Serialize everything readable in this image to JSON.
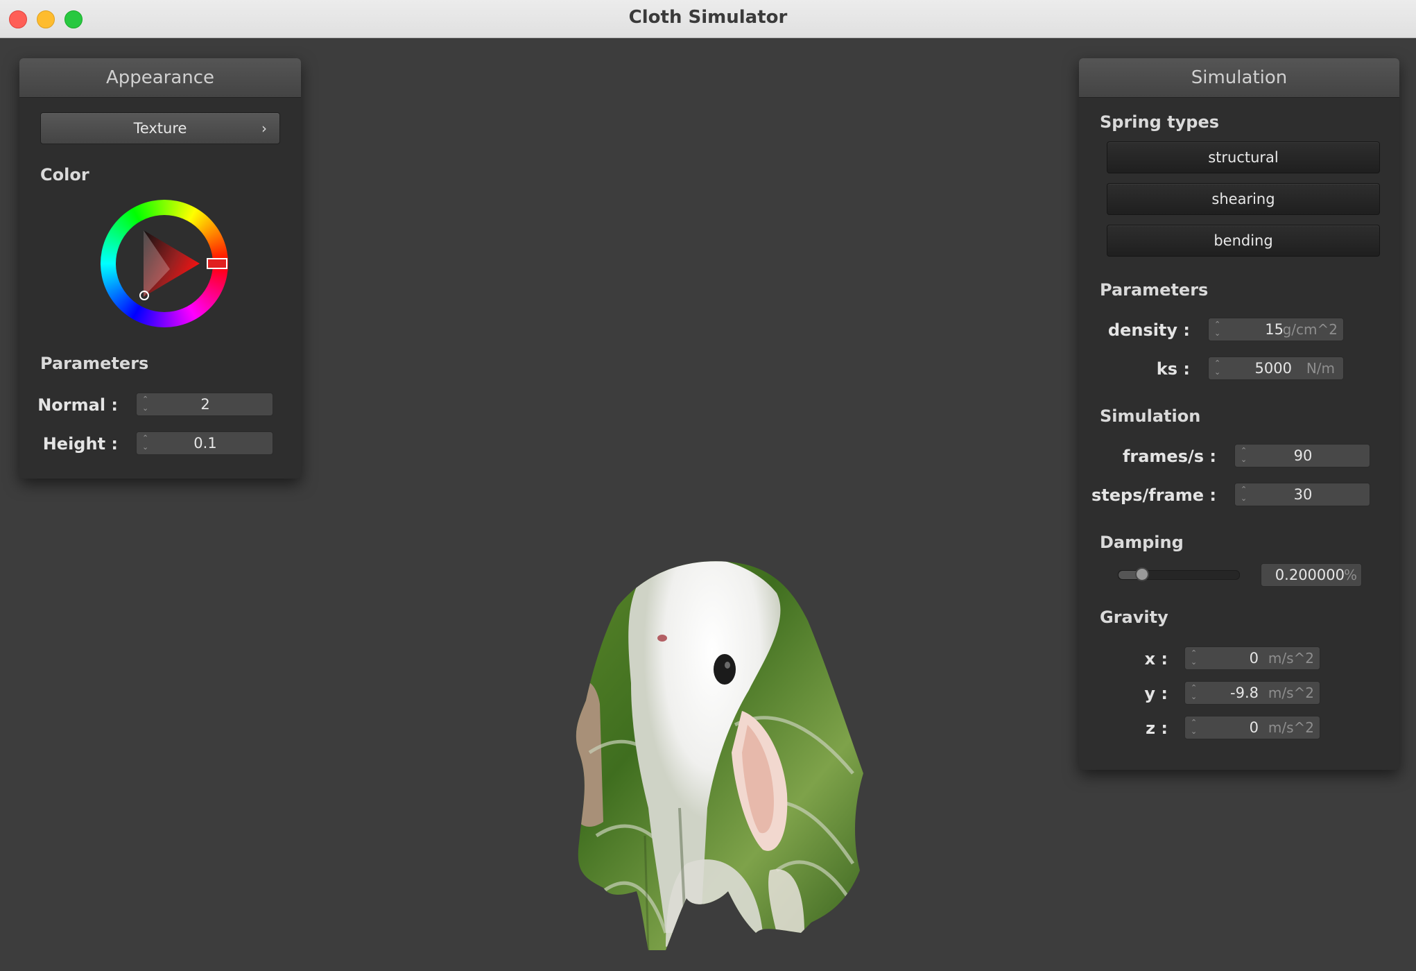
{
  "window": {
    "title": "Cloth Simulator"
  },
  "appearance": {
    "header": "Appearance",
    "texture_button": "Texture",
    "color_section": "Color",
    "color_value": "#e02020",
    "parameters_section": "Parameters",
    "normal": {
      "label": "Normal :",
      "value": "2"
    },
    "height": {
      "label": "Height :",
      "value": "0.1"
    }
  },
  "simulation": {
    "header": "Simulation",
    "spring_section": "Spring types",
    "spring_buttons": [
      "structural",
      "shearing",
      "bending"
    ],
    "parameters_section": "Parameters",
    "density": {
      "label": "density :",
      "value": "15",
      "unit": "g/cm^2"
    },
    "ks": {
      "label": "ks :",
      "value": "5000",
      "unit": "N/m"
    },
    "simulation_section": "Simulation",
    "frames": {
      "label": "frames/s :",
      "value": "90"
    },
    "steps": {
      "label": "steps/frame :",
      "value": "30"
    },
    "damping_section": "Damping",
    "damping": {
      "value": "0.200000",
      "unit": "%",
      "fraction": 0.2
    },
    "gravity_section": "Gravity",
    "gx": {
      "label": "x :",
      "value": "0",
      "unit": "m/s^2"
    },
    "gy": {
      "label": "y :",
      "value": "-9.8",
      "unit": "m/s^2"
    },
    "gz": {
      "label": "z :",
      "value": "0",
      "unit": "m/s^2"
    }
  }
}
